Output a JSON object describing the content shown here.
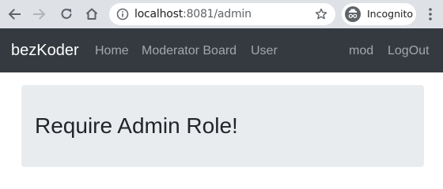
{
  "browser": {
    "url_host": "localhost",
    "url_port_path": ":8081/admin",
    "incognito_label": "Incognito",
    "icons": {
      "back": "back-arrow-icon",
      "forward": "forward-arrow-icon",
      "reload": "reload-icon",
      "home": "home-icon",
      "info": "info-icon",
      "star": "star-icon",
      "incognito": "incognito-icon",
      "menu": "kebab-menu-icon"
    }
  },
  "navbar": {
    "brand": "bezKoder",
    "links": {
      "home": "Home",
      "moderator": "Moderator Board",
      "user": "User",
      "profile": "mod",
      "logout": "LogOut"
    },
    "background": "#343a40"
  },
  "content": {
    "message": "Require Admin Role!",
    "panel_color": "#e9ecef"
  }
}
